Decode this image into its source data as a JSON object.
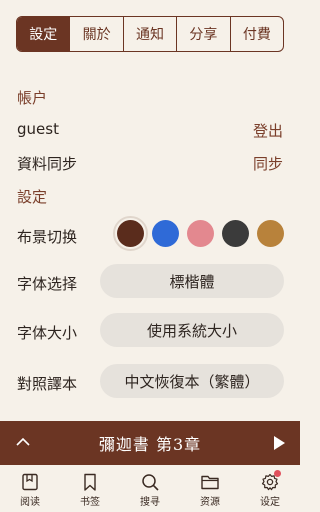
{
  "tabs": [
    {
      "label": "設定",
      "active": true
    },
    {
      "label": "關於",
      "active": false
    },
    {
      "label": "通知",
      "active": false
    },
    {
      "label": "分享",
      "active": false
    },
    {
      "label": "付費",
      "active": false
    }
  ],
  "account": {
    "section_label": "帳户",
    "username": "guest",
    "logout_label": "登出",
    "sync_label": "資料同步",
    "sync_action": "同步"
  },
  "settings": {
    "section_label": "設定",
    "background_label": "布景切换",
    "background_colors": [
      "#5a2c1c",
      "#2f6ad7",
      "#e3888f",
      "#3b3b3b",
      "#b8823b"
    ],
    "font_label": "字体选择",
    "font_value": "標楷體",
    "size_label": "字体大小",
    "size_value": "使用系統大小",
    "translation_label": "對照譯本",
    "translation_value": "中文恢復本（繁體）"
  },
  "reader": {
    "title": "彌迦書  第3章"
  },
  "nav": [
    {
      "label": "阅读",
      "icon": "book-icon"
    },
    {
      "label": "书签",
      "icon": "bookmark-icon"
    },
    {
      "label": "搜寻",
      "icon": "search-icon"
    },
    {
      "label": "资源",
      "icon": "folder-icon"
    },
    {
      "label": "设定",
      "icon": "gear-icon"
    }
  ],
  "colors": {
    "brand": "#6b3523",
    "background": "#f6f1e9",
    "pill": "#e6e2dc",
    "badge": "#e0505c"
  }
}
